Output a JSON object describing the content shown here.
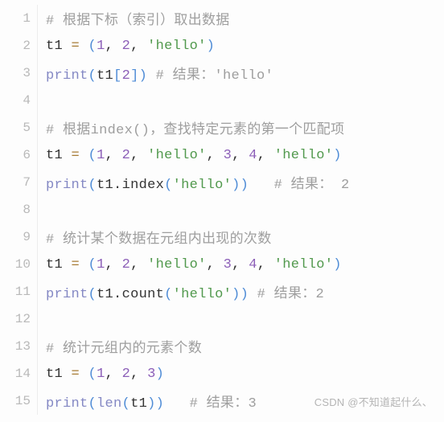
{
  "watermark": "CSDN @不知道起什么、",
  "lines": [
    {
      "n": 1,
      "tokens": [
        {
          "c": "tok-comment",
          "t": "# 根据下标（索引）取出数据"
        }
      ]
    },
    {
      "n": 2,
      "tokens": [
        {
          "c": "tok-ident",
          "t": "t1 "
        },
        {
          "c": "tok-op",
          "t": "="
        },
        {
          "c": "tok-ident",
          "t": " "
        },
        {
          "c": "tok-paren",
          "t": "("
        },
        {
          "c": "tok-number",
          "t": "1"
        },
        {
          "c": "tok-punct",
          "t": ", "
        },
        {
          "c": "tok-number",
          "t": "2"
        },
        {
          "c": "tok-punct",
          "t": ", "
        },
        {
          "c": "tok-string",
          "t": "'hello'"
        },
        {
          "c": "tok-paren",
          "t": ")"
        }
      ]
    },
    {
      "n": 3,
      "tokens": [
        {
          "c": "tok-builtin",
          "t": "print"
        },
        {
          "c": "tok-paren",
          "t": "("
        },
        {
          "c": "tok-ident",
          "t": "t1"
        },
        {
          "c": "tok-bracket",
          "t": "["
        },
        {
          "c": "tok-number",
          "t": "2"
        },
        {
          "c": "tok-bracket",
          "t": "]"
        },
        {
          "c": "tok-paren",
          "t": ")"
        },
        {
          "c": "tok-ident",
          "t": " "
        },
        {
          "c": "tok-comment",
          "t": "# 结果：'hello'"
        }
      ]
    },
    {
      "n": 4,
      "tokens": []
    },
    {
      "n": 5,
      "tokens": [
        {
          "c": "tok-comment",
          "t": "# 根据index()，查找特定元素的第一个匹配项"
        }
      ]
    },
    {
      "n": 6,
      "tokens": [
        {
          "c": "tok-ident",
          "t": "t1 "
        },
        {
          "c": "tok-op",
          "t": "="
        },
        {
          "c": "tok-ident",
          "t": " "
        },
        {
          "c": "tok-paren",
          "t": "("
        },
        {
          "c": "tok-number",
          "t": "1"
        },
        {
          "c": "tok-punct",
          "t": ", "
        },
        {
          "c": "tok-number",
          "t": "2"
        },
        {
          "c": "tok-punct",
          "t": ", "
        },
        {
          "c": "tok-string",
          "t": "'hello'"
        },
        {
          "c": "tok-punct",
          "t": ", "
        },
        {
          "c": "tok-number",
          "t": "3"
        },
        {
          "c": "tok-punct",
          "t": ", "
        },
        {
          "c": "tok-number",
          "t": "4"
        },
        {
          "c": "tok-punct",
          "t": ", "
        },
        {
          "c": "tok-string",
          "t": "'hello'"
        },
        {
          "c": "tok-paren",
          "t": ")"
        }
      ]
    },
    {
      "n": 7,
      "tokens": [
        {
          "c": "tok-builtin",
          "t": "print"
        },
        {
          "c": "tok-paren",
          "t": "("
        },
        {
          "c": "tok-ident",
          "t": "t1"
        },
        {
          "c": "tok-punct",
          "t": "."
        },
        {
          "c": "tok-ident",
          "t": "index"
        },
        {
          "c": "tok-paren",
          "t": "("
        },
        {
          "c": "tok-string",
          "t": "'hello'"
        },
        {
          "c": "tok-paren",
          "t": ")"
        },
        {
          "c": "tok-paren",
          "t": ")"
        },
        {
          "c": "tok-ident",
          "t": "   "
        },
        {
          "c": "tok-comment",
          "t": "# 结果： 2"
        }
      ]
    },
    {
      "n": 8,
      "tokens": []
    },
    {
      "n": 9,
      "tokens": [
        {
          "c": "tok-comment",
          "t": "# 统计某个数据在元组内出现的次数"
        }
      ]
    },
    {
      "n": 10,
      "tokens": [
        {
          "c": "tok-ident",
          "t": "t1 "
        },
        {
          "c": "tok-op",
          "t": "="
        },
        {
          "c": "tok-ident",
          "t": " "
        },
        {
          "c": "tok-paren",
          "t": "("
        },
        {
          "c": "tok-number",
          "t": "1"
        },
        {
          "c": "tok-punct",
          "t": ", "
        },
        {
          "c": "tok-number",
          "t": "2"
        },
        {
          "c": "tok-punct",
          "t": ", "
        },
        {
          "c": "tok-string",
          "t": "'hello'"
        },
        {
          "c": "tok-punct",
          "t": ", "
        },
        {
          "c": "tok-number",
          "t": "3"
        },
        {
          "c": "tok-punct",
          "t": ", "
        },
        {
          "c": "tok-number",
          "t": "4"
        },
        {
          "c": "tok-punct",
          "t": ", "
        },
        {
          "c": "tok-string",
          "t": "'hello'"
        },
        {
          "c": "tok-paren",
          "t": ")"
        }
      ]
    },
    {
      "n": 11,
      "tokens": [
        {
          "c": "tok-builtin",
          "t": "print"
        },
        {
          "c": "tok-paren",
          "t": "("
        },
        {
          "c": "tok-ident",
          "t": "t1"
        },
        {
          "c": "tok-punct",
          "t": "."
        },
        {
          "c": "tok-ident",
          "t": "count"
        },
        {
          "c": "tok-paren",
          "t": "("
        },
        {
          "c": "tok-string",
          "t": "'hello'"
        },
        {
          "c": "tok-paren",
          "t": ")"
        },
        {
          "c": "tok-paren",
          "t": ")"
        },
        {
          "c": "tok-ident",
          "t": " "
        },
        {
          "c": "tok-comment",
          "t": "# 结果：2"
        }
      ]
    },
    {
      "n": 12,
      "tokens": []
    },
    {
      "n": 13,
      "tokens": [
        {
          "c": "tok-comment",
          "t": "# 统计元组内的元素个数"
        }
      ]
    },
    {
      "n": 14,
      "tokens": [
        {
          "c": "tok-ident",
          "t": "t1 "
        },
        {
          "c": "tok-op",
          "t": "="
        },
        {
          "c": "tok-ident",
          "t": " "
        },
        {
          "c": "tok-paren",
          "t": "("
        },
        {
          "c": "tok-number",
          "t": "1"
        },
        {
          "c": "tok-punct",
          "t": ", "
        },
        {
          "c": "tok-number",
          "t": "2"
        },
        {
          "c": "tok-punct",
          "t": ", "
        },
        {
          "c": "tok-number",
          "t": "3"
        },
        {
          "c": "tok-paren",
          "t": ")"
        }
      ]
    },
    {
      "n": 15,
      "tokens": [
        {
          "c": "tok-builtin",
          "t": "print"
        },
        {
          "c": "tok-paren",
          "t": "("
        },
        {
          "c": "tok-builtin",
          "t": "len"
        },
        {
          "c": "tok-paren",
          "t": "("
        },
        {
          "c": "tok-ident",
          "t": "t1"
        },
        {
          "c": "tok-paren",
          "t": ")"
        },
        {
          "c": "tok-paren",
          "t": ")"
        },
        {
          "c": "tok-ident",
          "t": "   "
        },
        {
          "c": "tok-comment",
          "t": "# 结果：3"
        }
      ]
    }
  ]
}
